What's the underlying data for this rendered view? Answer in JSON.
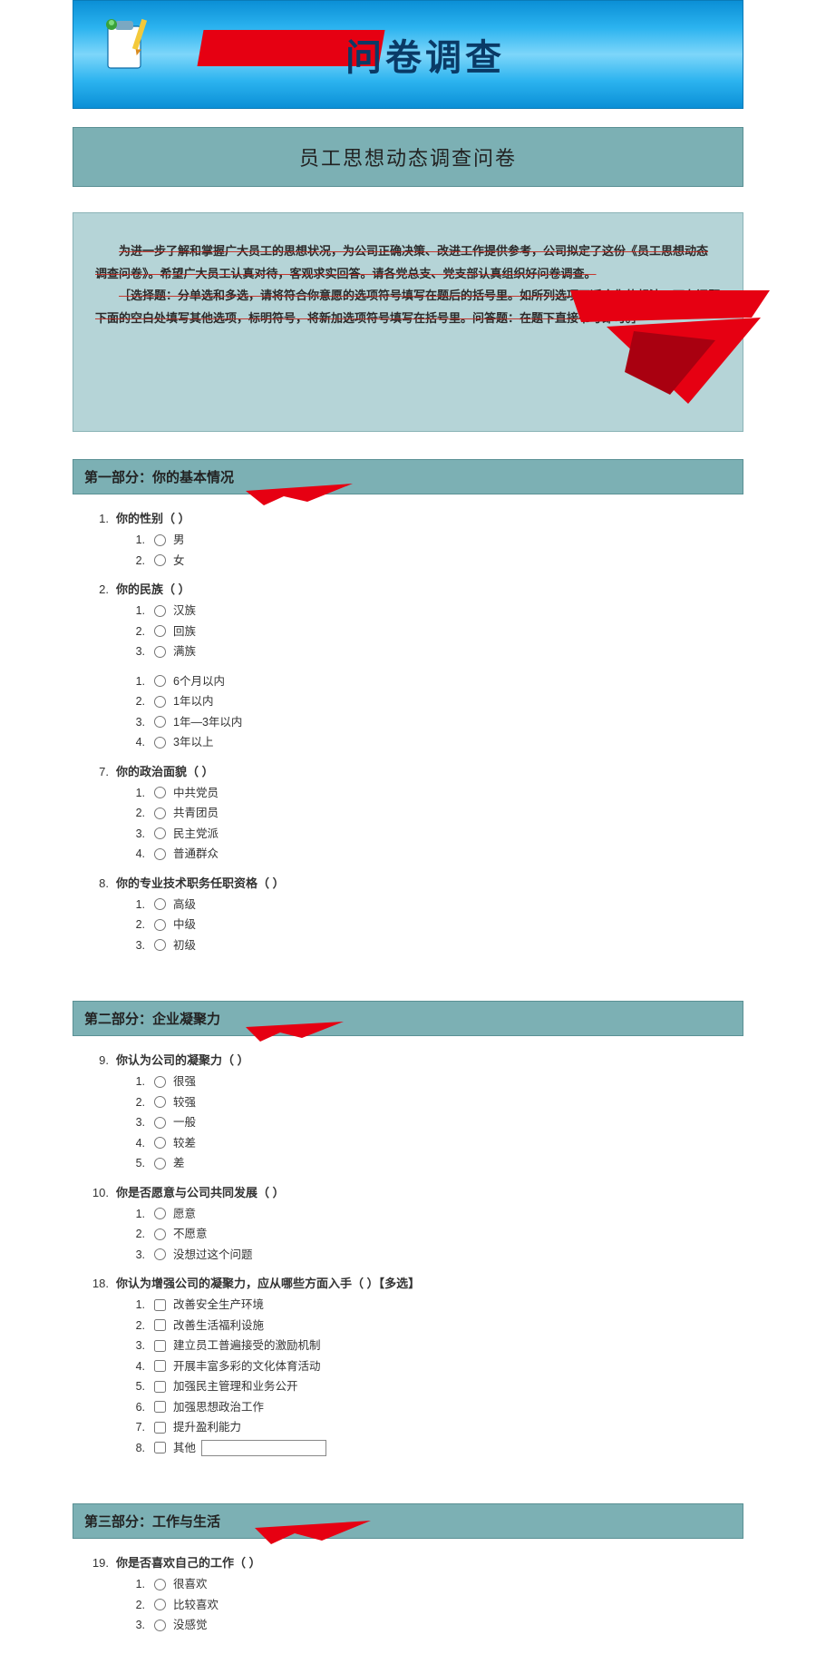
{
  "banner": {
    "title": "问卷调查"
  },
  "subtitle": "员工思想动态调查问卷",
  "intro": {
    "p1": "为进一步了解和掌握广大员工的思想状况，为公司正确决策、改进工作提供参考，公司拟定了这份《员工思想动态 调查问卷》。希望广大员工认真对待，客观求实回答。请各党总支、党支部认真组织好问卷调查。",
    "p2": "［选择题：分单选和多选，请将符合你意愿的选项符号填写在题后的括号里。如所列选项不适合你的想法，可在问题下面的空白处填写其他选项，标明符号，将新加选项符号填写在括号里。问答题：在题下直接书写即可。］"
  },
  "sections": [
    {
      "title": "第一部分：你的基本情况"
    },
    {
      "title": "第二部分：企业凝聚力"
    },
    {
      "title": "第三部分：工作与生活"
    }
  ],
  "q1": {
    "num": "1.",
    "text": "你的性别（ ）",
    "opts": [
      "男",
      "女"
    ]
  },
  "q2": {
    "num": "2.",
    "text": "你的民族（ ）",
    "opts": [
      "汉族",
      "回族",
      "满族"
    ]
  },
  "qX": {
    "num": "",
    "text": "",
    "opts": [
      "6个月以内",
      "1年以内",
      "1年—3年以内",
      "3年以上"
    ]
  },
  "q7": {
    "num": "7.",
    "text": "你的政治面貌（ ）",
    "opts": [
      "中共党员",
      "共青团员",
      "民主党派",
      "普通群众"
    ]
  },
  "q8": {
    "num": "8.",
    "text": "你的专业技术职务任职资格（ ）",
    "opts": [
      "高级",
      "中级",
      "初级"
    ]
  },
  "q9": {
    "num": "9.",
    "text": "你认为公司的凝聚力（ ）",
    "opts": [
      "很强",
      "较强",
      "一般",
      "较差",
      "差"
    ]
  },
  "q10": {
    "num": "10.",
    "text": "你是否愿意与公司共同发展（ ）",
    "opts": [
      "愿意",
      "不愿意",
      "没想过这个问题"
    ]
  },
  "q18": {
    "num": "18.",
    "text": "你认为增强公司的凝聚力，应从哪些方面入手（ ）【多选】",
    "opts": [
      "改善安全生产环境",
      "改善生活福利设施",
      "建立员工普遍接受的激励机制",
      "开展丰富多彩的文化体育活动",
      "加强民主管理和业务公开",
      "加强思想政治工作",
      "提升盈利能力",
      "其他"
    ]
  },
  "q19": {
    "num": "19.",
    "text": "你是否喜欢自己的工作（ ）",
    "opts": [
      "很喜欢",
      "比较喜欢",
      "没感觉"
    ]
  }
}
